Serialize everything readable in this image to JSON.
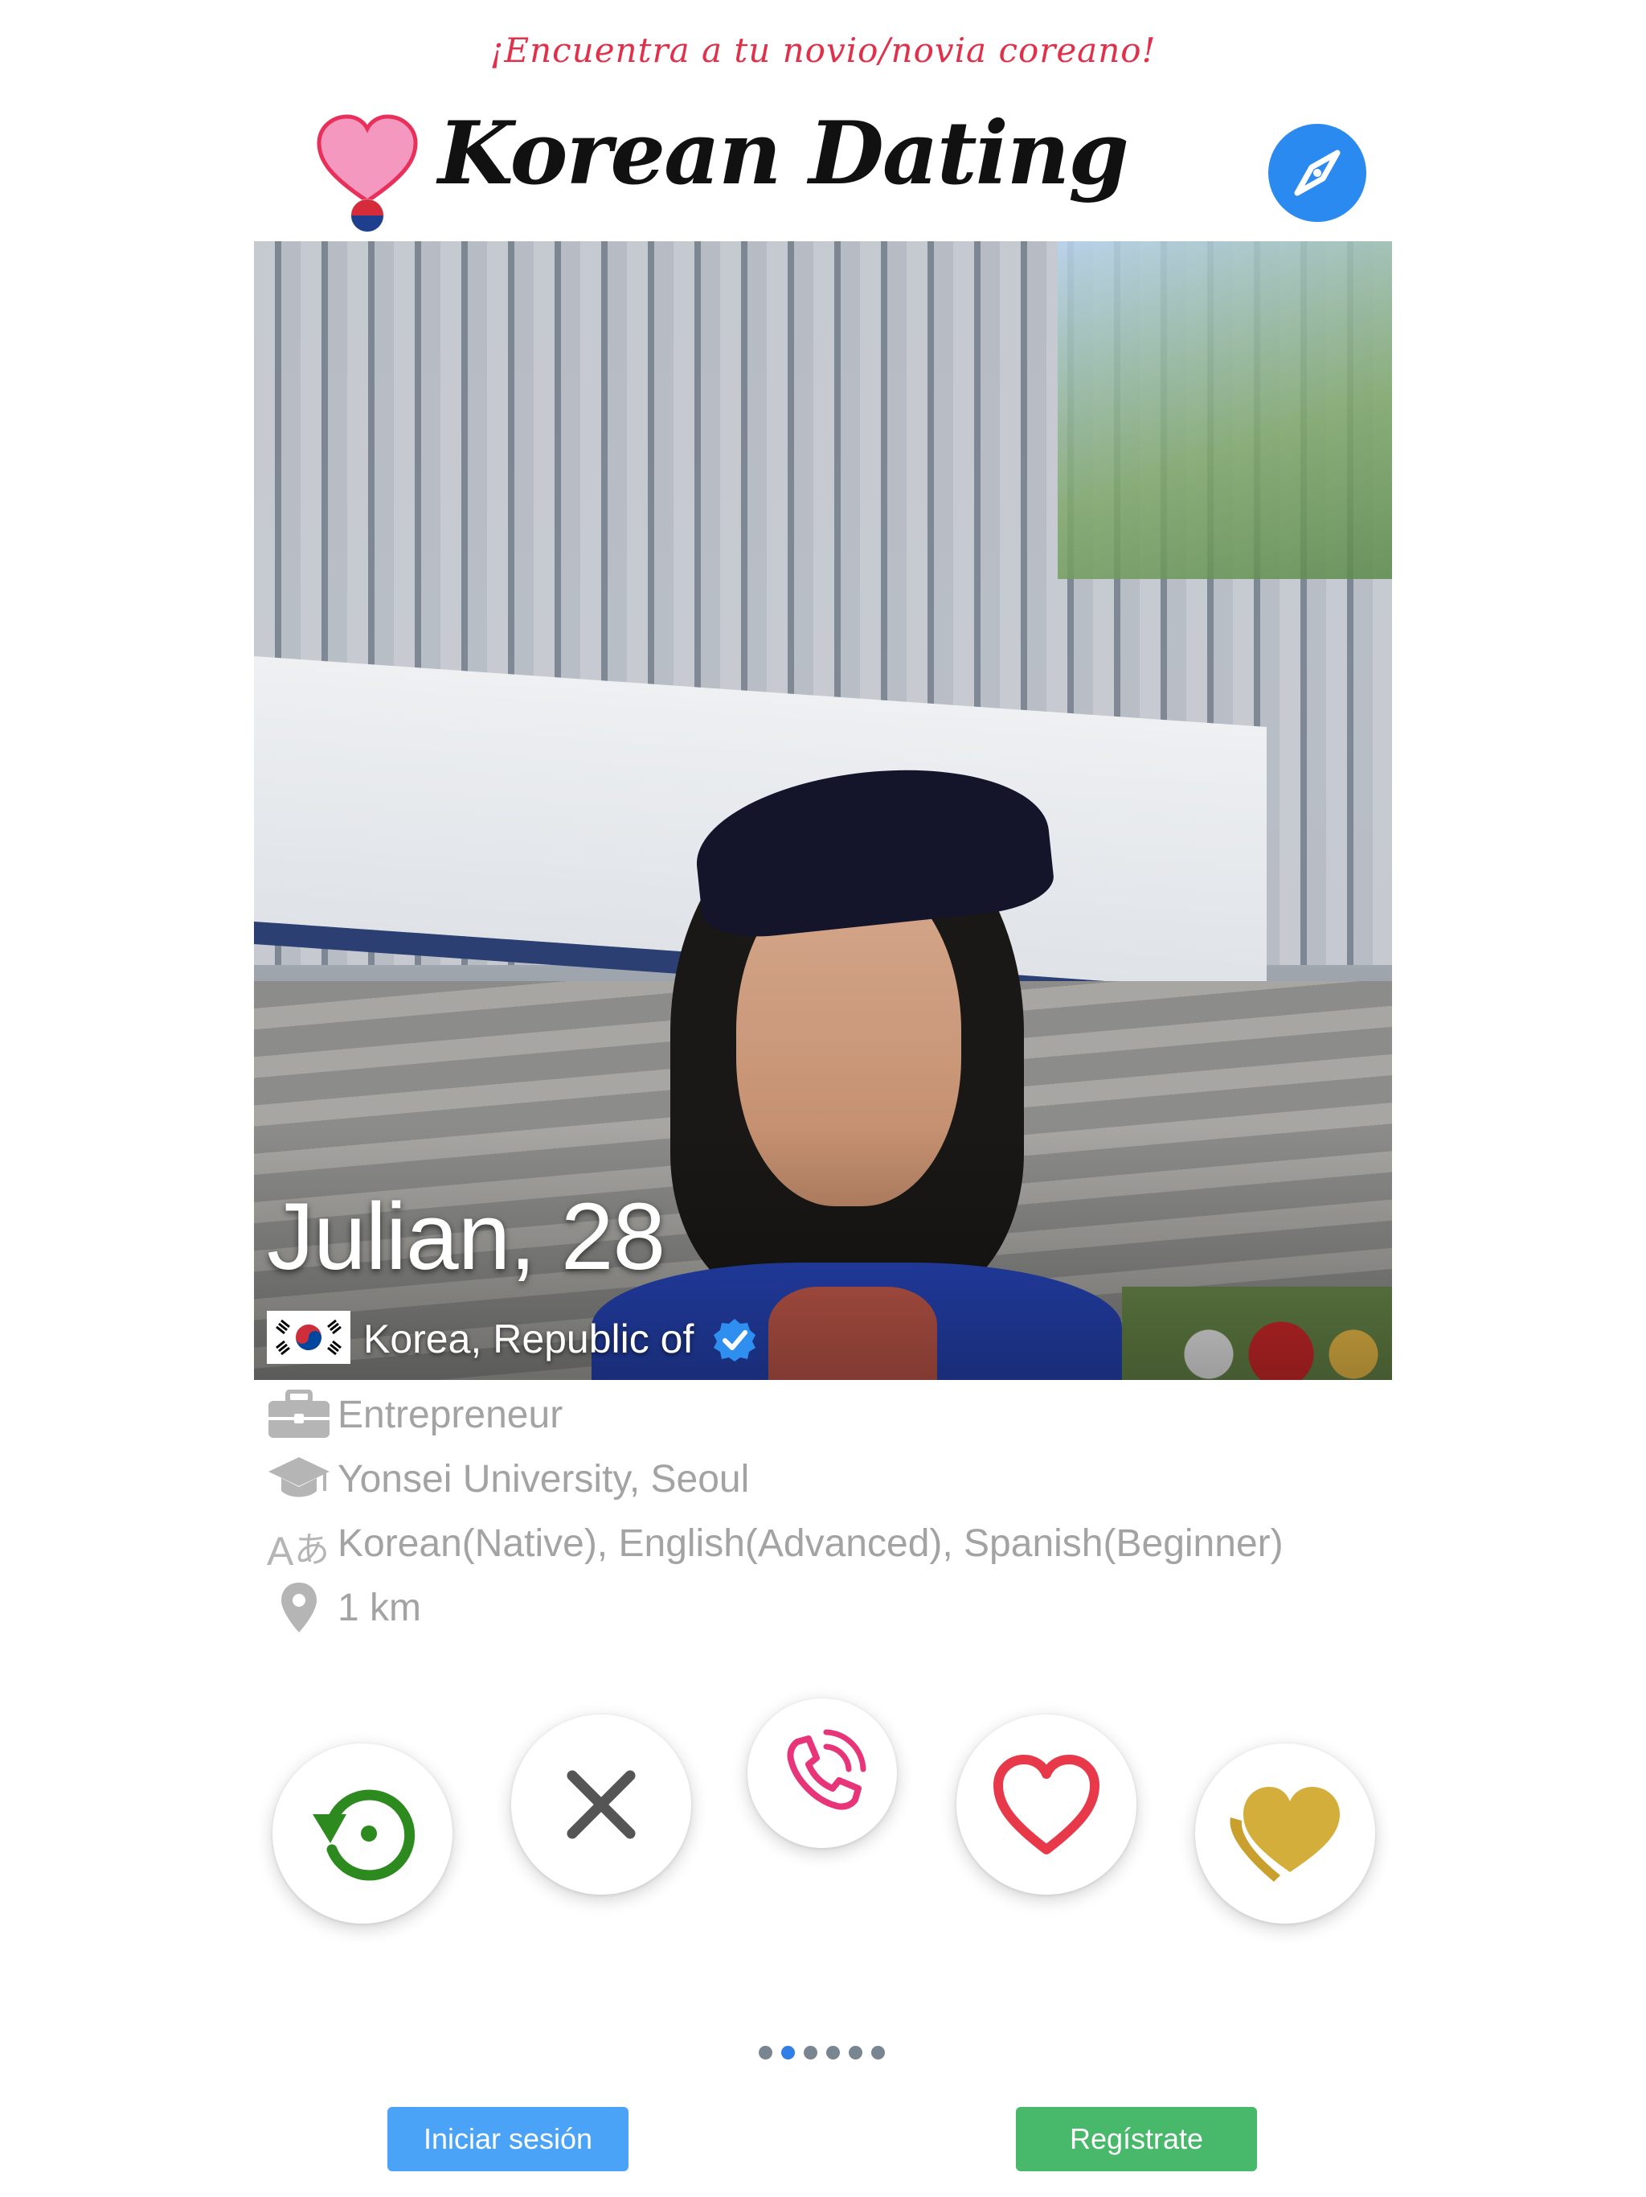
{
  "header": {
    "tagline": "¡Encuentra a tu novio/novia coreano!",
    "app_title": "Korean Dating",
    "explore_icon": "compass-icon"
  },
  "profile": {
    "name_age": "Julian, 28",
    "country": "Korea, Republic of",
    "verified": true,
    "occupation": "Entrepreneur",
    "education": "Yonsei University, Seoul",
    "languages": "Korean(Native), English(Advanced), Spanish(Beginner)",
    "distance": "1 km"
  },
  "actions": [
    {
      "name": "rewind",
      "icon": "rewind-icon",
      "color": "#2d8a1e"
    },
    {
      "name": "nope",
      "icon": "close-icon",
      "color": "#555555"
    },
    {
      "name": "call",
      "icon": "phone-icon",
      "color": "#e8357a"
    },
    {
      "name": "like",
      "icon": "heart-outline-icon",
      "color": "#e8394a"
    },
    {
      "name": "superlike",
      "icon": "gold-heart-icon",
      "color": "#d4ae3a"
    }
  ],
  "pager": {
    "count": 6,
    "active_index": 1
  },
  "footer": {
    "login_label": "Iniciar sesión",
    "signup_label": "Regístrate"
  },
  "colors": {
    "tagline": "#e0304a",
    "accent_blue": "#2b8af0",
    "login_button": "#4aa3f7",
    "signup_button": "#48b86a",
    "detail_text": "#a3a3a3"
  }
}
